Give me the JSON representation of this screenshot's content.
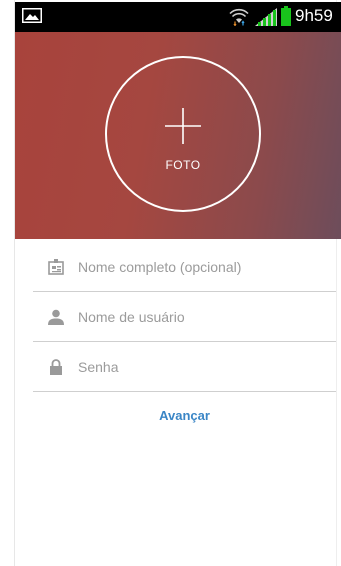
{
  "status_bar": {
    "time": "9h59",
    "icons": [
      "image-icon",
      "wifi-icon",
      "signal-icon",
      "battery-icon"
    ],
    "battery_color": "#19c41c"
  },
  "header": {
    "photo_label": "FOTO",
    "plus_icon": "plus-icon",
    "gradient_start": "#a8433c",
    "gradient_end": "#6d4d5b"
  },
  "form": {
    "full_name": {
      "placeholder": "Nome completo (opcional)",
      "value": "",
      "icon": "id-card-icon"
    },
    "username": {
      "placeholder": "Nome de usuário",
      "value": "",
      "icon": "person-icon"
    },
    "password": {
      "placeholder": "Senha",
      "value": "",
      "icon": "lock-icon"
    },
    "next_label": "Avançar",
    "accent_color": "#3b86c6"
  }
}
